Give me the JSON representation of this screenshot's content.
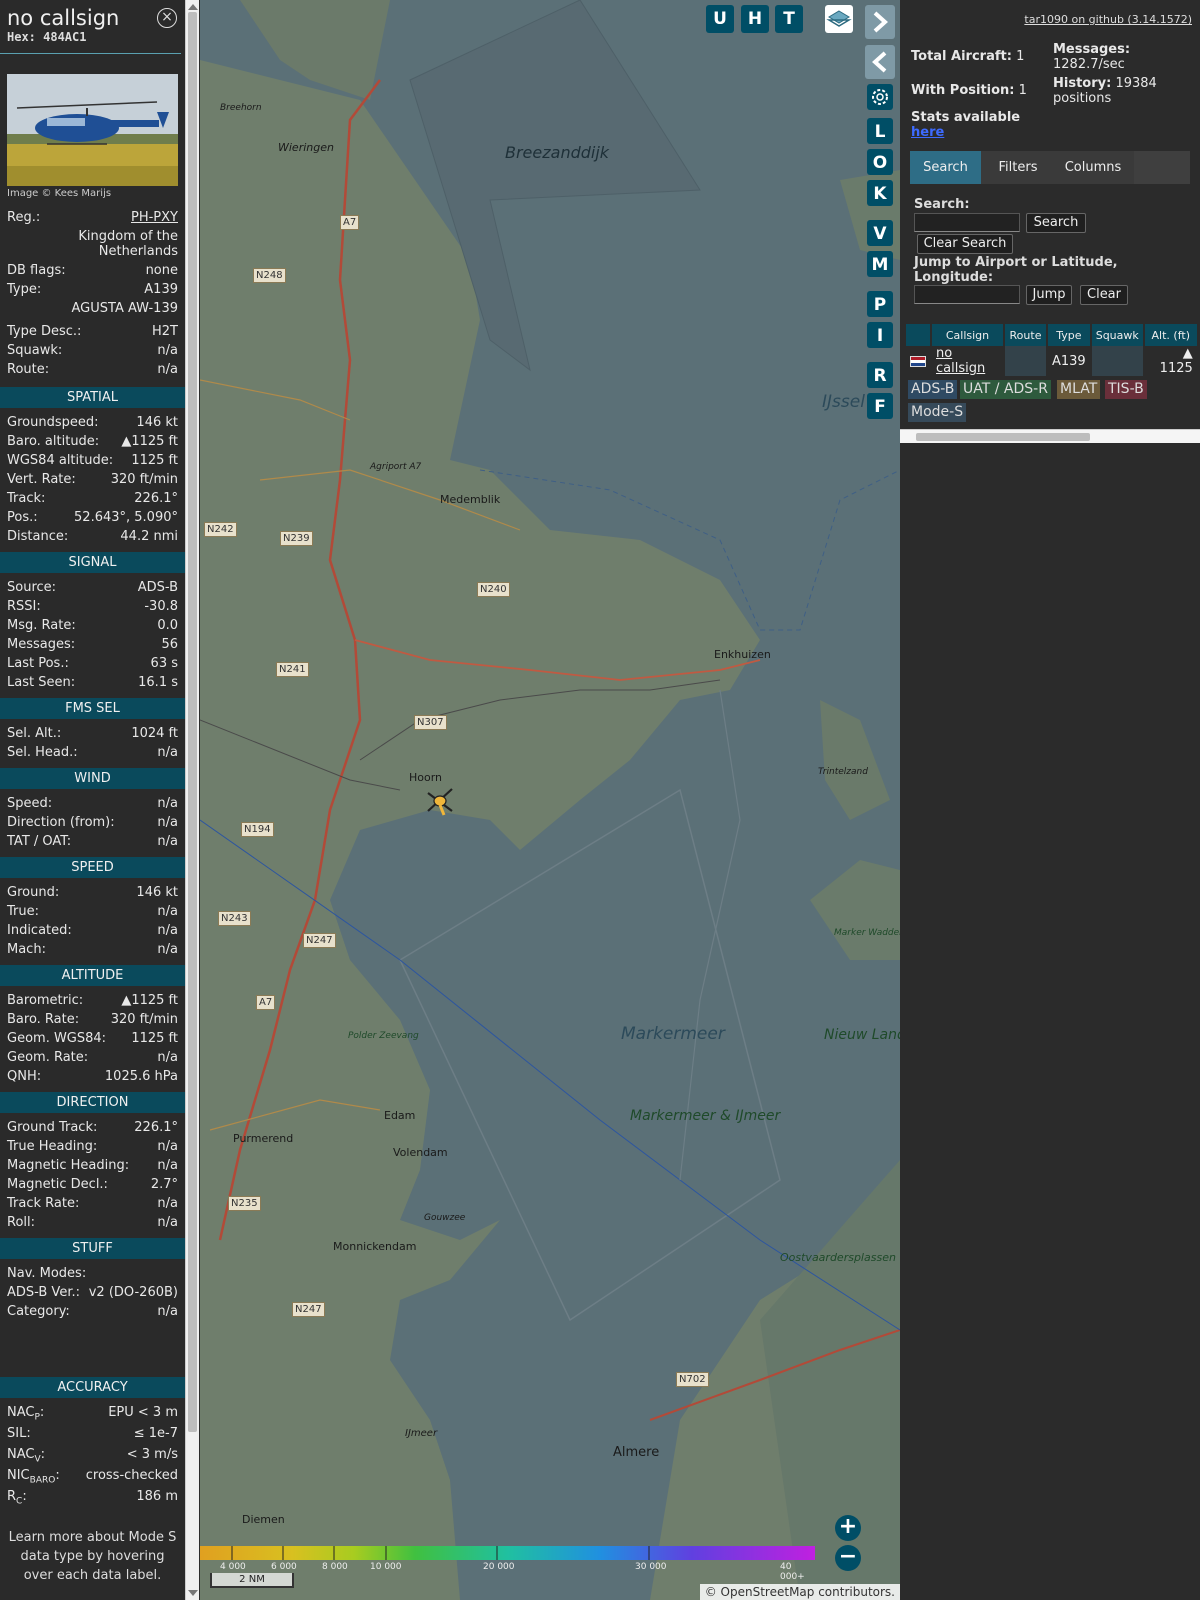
{
  "infopanel": {
    "callsign": "no callsign",
    "hex": "Hex: 484AC1",
    "close_icon": "×",
    "photo_caption": "Image © Kees Marijs",
    "basic": [
      {
        "k": "Reg.:",
        "v": "PH-PXY"
      },
      {
        "k": "",
        "v": "Kingdom of the"
      },
      {
        "k": "",
        "v": "Netherlands"
      },
      {
        "k": "DB flags:",
        "v": "none"
      },
      {
        "k": "Type:",
        "v": "A139"
      },
      {
        "k": "",
        "v": "AGUSTA AW-139"
      }
    ],
    "basic2": [
      {
        "k": "Type Desc.:",
        "v": "H2T"
      },
      {
        "k": "Squawk:",
        "v": "n/a"
      },
      {
        "k": "Route:",
        "v": "n/a"
      }
    ],
    "sections": [
      {
        "title": "SPATIAL",
        "rows": [
          {
            "k": "Groundspeed:",
            "v": "146 kt"
          },
          {
            "k": "Baro. altitude:",
            "v": "▲1125 ft"
          },
          {
            "k": "WGS84 altitude:",
            "v": "1125 ft"
          },
          {
            "k": "Vert. Rate:",
            "v": "320 ft/min"
          },
          {
            "k": "Track:",
            "v": "226.1°"
          },
          {
            "k": "Pos.:",
            "v": "52.643°, 5.090°"
          },
          {
            "k": "Distance:",
            "v": "44.2 nmi"
          }
        ]
      },
      {
        "title": "SIGNAL",
        "rows": [
          {
            "k": "Source:",
            "v": "ADS-B"
          },
          {
            "k": "RSSI:",
            "v": "-30.8"
          },
          {
            "k": "Msg. Rate:",
            "v": "0.0"
          },
          {
            "k": "Messages:",
            "v": "56"
          },
          {
            "k": "Last Pos.:",
            "v": "63 s"
          },
          {
            "k": "Last Seen:",
            "v": "16.1 s"
          }
        ]
      },
      {
        "title": "FMS SEL",
        "rows": [
          {
            "k": "Sel. Alt.:",
            "v": "1024 ft"
          },
          {
            "k": "Sel. Head.:",
            "v": "n/a"
          }
        ]
      },
      {
        "title": "WIND",
        "rows": [
          {
            "k": "Speed:",
            "v": "n/a"
          },
          {
            "k": "Direction (from):",
            "v": "n/a"
          },
          {
            "k": "TAT / OAT:",
            "v": "n/a"
          }
        ]
      },
      {
        "title": "SPEED",
        "rows": [
          {
            "k": "Ground:",
            "v": "146 kt"
          },
          {
            "k": "True:",
            "v": "n/a"
          },
          {
            "k": "Indicated:",
            "v": "n/a"
          },
          {
            "k": "Mach:",
            "v": "n/a"
          }
        ]
      },
      {
        "title": "ALTITUDE",
        "rows": [
          {
            "k": "Barometric:",
            "v": "▲1125 ft"
          },
          {
            "k": "Baro. Rate:",
            "v": "320 ft/min"
          },
          {
            "k": "Geom. WGS84:",
            "v": "1125 ft"
          },
          {
            "k": "Geom. Rate:",
            "v": "n/a"
          },
          {
            "k": "QNH:",
            "v": "1025.6 hPa"
          }
        ]
      },
      {
        "title": "DIRECTION",
        "rows": [
          {
            "k": "Ground Track:",
            "v": "226.1°"
          },
          {
            "k": "True Heading:",
            "v": "n/a"
          },
          {
            "k": "Magnetic Heading:",
            "v": "n/a"
          },
          {
            "k": "Magnetic Decl.:",
            "v": "2.7°"
          },
          {
            "k": "Track Rate:",
            "v": "n/a"
          },
          {
            "k": "Roll:",
            "v": "n/a"
          }
        ]
      },
      {
        "title": "STUFF",
        "rows": [
          {
            "k": "Nav. Modes:",
            "v": ""
          },
          {
            "k": "ADS-B Ver.:",
            "v": "v2 (DO-260B)"
          },
          {
            "k": "Category:",
            "v": "n/a"
          }
        ]
      }
    ],
    "accuracy": {
      "title": "ACCURACY",
      "nacp_k": "NAC",
      "nacp_sub": "P",
      "nacp_v": "EPU < 3 m",
      "sil_k": "SIL:",
      "sil_v": "≤ 1e-7",
      "nacv_k": "NAC",
      "nacv_sub": "V",
      "nacv_v": "< 3 m/s",
      "nicbaro_k": "NIC",
      "nicbaro_sub": "BARO",
      "nicbaro_v": "cross-checked",
      "rc_k": "R",
      "rc_sub": "C",
      "rc_v": "186 m"
    },
    "footer_note": "Learn more about Mode S data type by hovering over each data label."
  },
  "map": {
    "buttons_top": [
      "U",
      "H",
      "T"
    ],
    "buttons_side": [
      "L",
      "O",
      "K",
      "V",
      "M",
      "P",
      "I",
      "R",
      "F"
    ],
    "place_labels": {
      "breezanddijk": "Breezanddijk",
      "wieringen": "Wieringen",
      "medemblik": "Medemblik",
      "enkhuizen": "Enkhuizen",
      "hoorn": "Hoorn",
      "edam": "Edam",
      "volendam": "Volendam",
      "purmerend": "Purmerend",
      "monnickendam": "Monnickendam",
      "almere": "Almere",
      "diemen": "Diemen",
      "agriport": "Agriport A7",
      "breehorn": "Breehorn",
      "trintelzand": "Trintelzand",
      "markerwadden": "Marker Wadden",
      "oostvaarders": "Oostvaardersplassen",
      "gouwzee": "Gouwzee",
      "ijmeer": "IJmeer",
      "ijssel": "IJssel",
      "polder_zeevang": "Polder Zeevang"
    },
    "water_labels": {
      "markermeer": "Markermeer",
      "markermeer_ijmeer": "Markermeer & IJmeer",
      "nieuw_land": "Nieuw Land"
    },
    "road_labels": {
      "a7_1": "A7",
      "a7_2": "A7",
      "n248": "N248",
      "n242": "N242",
      "n239": "N239",
      "n240": "N240",
      "n241": "N241",
      "n307": "N307",
      "n194": "N194",
      "n243": "N243",
      "n247": "N247",
      "n247b": "N247",
      "n235": "N235",
      "n702": "N702"
    },
    "altitude_scale": [
      "4 000",
      "6 000",
      "8 000",
      "10 000",
      "20 000",
      "30 000",
      "40 000+"
    ],
    "scale_label": "2 NM",
    "zoom_in": "+",
    "zoom_out": "−",
    "attribution": "© OpenStreetMap contributors."
  },
  "sidebar": {
    "github_link": "tar1090 on github (3.14.1572)",
    "total_aircraft_label": "Total Aircraft:",
    "total_aircraft_value": "1",
    "with_position_label": "With Position:",
    "with_position_value": "1",
    "messages_label": "Messages:",
    "messages_value": "1282.7/sec",
    "history_label": "History:",
    "history_value": "19384 positions",
    "stats_text": "Stats available",
    "stats_link": "here",
    "tabs": [
      "Search",
      "Filters",
      "Columns"
    ],
    "search_label": "Search:",
    "search_button": "Search",
    "clear_search_button": "Clear Search",
    "jump_label": "Jump to Airport or Latitude, Longitude:",
    "jump_button": "Jump",
    "clear_button": "Clear",
    "table": {
      "headers": [
        "Callsign",
        "Route",
        "Type",
        "Squawk",
        "Alt. (ft)"
      ],
      "row": {
        "callsign": "no callsign",
        "route": "",
        "type": "A139",
        "squawk": "",
        "alt": "▲ 1125"
      }
    },
    "legend": [
      {
        "label": "ADS-B",
        "color": "#2f4a63"
      },
      {
        "label": "UAT / ADS-R",
        "color": "#2e5a3d"
      },
      {
        "label": "MLAT",
        "color": "#6b5a3a"
      },
      {
        "label": "TIS-B",
        "color": "#6a2f3a"
      },
      {
        "label": "Mode-S",
        "color": "#364a5a"
      }
    ]
  },
  "colors": {
    "header_teal": "#0a4a5c",
    "button_teal": "#004e66",
    "active_tab": "#2e6d86",
    "panel_bg": "#2a2a2a"
  }
}
